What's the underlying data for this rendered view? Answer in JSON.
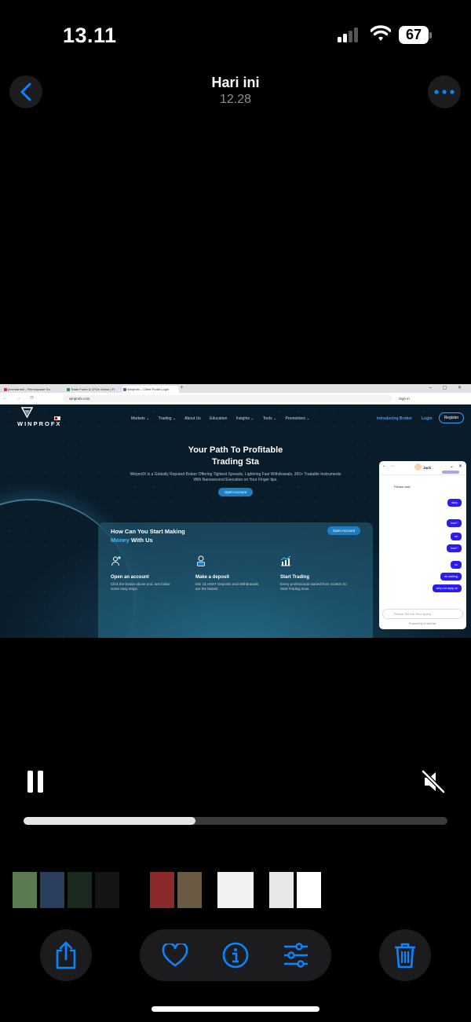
{
  "status_bar": {
    "time": "13.11",
    "battery": "67"
  },
  "nav": {
    "title": "Hari ini",
    "subtitle": "12.28"
  },
  "browser": {
    "tabs": [
      {
        "label": "jenredantall – Remotycase Gu",
        "color": "#cc3333"
      },
      {
        "label": "Trade Forex & CFDs Online | Fr",
        "color": "#2e8b57"
      },
      {
        "label": "Winprofx – Client Portal Login",
        "color": "#4466cc"
      }
    ],
    "url": "winprofx.com",
    "sign_in": "Sign in"
  },
  "site": {
    "logo": "WINPROFX",
    "menu": [
      "Markets ⌄",
      "Trading ⌄",
      "About Us",
      "Education",
      "Insights ⌄",
      "Tools ⌄",
      "Promotions ⌄"
    ],
    "introducing_broker": "Introducing Broker",
    "login": "Login",
    "register": "Register",
    "hero_title_line1": "Your Path To Profitable",
    "hero_title_line2": "Trading Sta",
    "hero_desc": "WinprofX is a Globally Reputed Broker Offering Tightest Spreads, Lightning Fast Withdrawals, 300+ Tradable Instruments With Nanosecond Execution on Your Finger tips.",
    "hero_button": "Open Account",
    "card": {
      "title_line1": "How Can You Start Making",
      "title_accent": "Money",
      "title_rest": " With Us",
      "button": "Open Account",
      "steps": [
        {
          "title": "Open an account",
          "desc": "Click the button above and Just follow some easy steps."
        },
        {
          "title": "Make a deposit",
          "desc": "Min 1$ USDT Deposits and Withdrawals are the fastest."
        },
        {
          "title": "Start Trading",
          "desc": "Every professional started from scratch So Start Trading Now."
        }
      ]
    }
  },
  "chat": {
    "agent": "Jack",
    "incoming": "Please wait",
    "outgoing": [
      "okey",
      "how?",
      "sir",
      "how?",
      "ss",
      "im waiting",
      "why not reply sir"
    ],
    "placeholder": "Please Tell Me Your Query",
    "powered": "Powered by ● LiveChat"
  },
  "player": {
    "progress": 0.405
  },
  "thumbnails": [
    "#5a7a52",
    "#2a3f5c",
    "#1b2a1e",
    "#141414",
    "#000000",
    "#8a2a2a",
    "#6a5a44",
    "#f2f2f2",
    "#e8e8e8",
    "#ffffff",
    "#f0f0f0"
  ],
  "colors": {
    "accent": "#0a84ff",
    "brand": "#1c7fc3",
    "chat_bubble": "#2b1cf0"
  }
}
